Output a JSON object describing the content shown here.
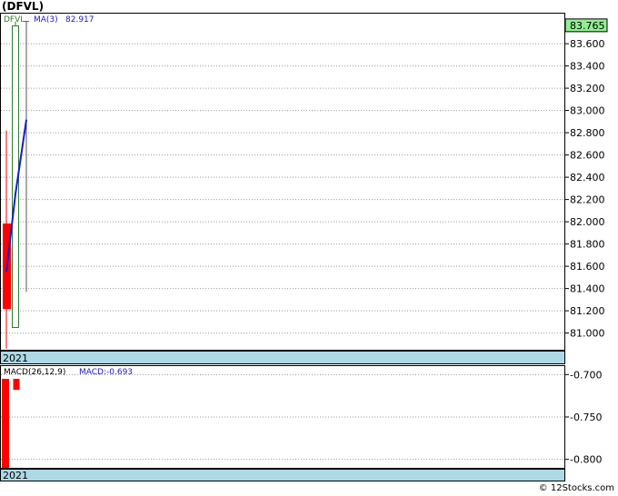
{
  "header": {
    "title": "(DFVL)"
  },
  "price_panel": {
    "legend_symbol": "DFVL",
    "legend_ma_label": "MA(3)",
    "legend_ma_value": "82.917",
    "last_price_tag": "83.765",
    "year_label": "2021"
  },
  "macd_panel": {
    "legend_label": "MACD(26,12,9)",
    "legend_value": "MACD:-0.693",
    "year_label": "2021"
  },
  "footer": {
    "watermark": "© 12Stocks.com"
  },
  "colors": {
    "up": "#2e7d2e",
    "down": "#ff0000",
    "ma_line": "#1a1acc",
    "legend_text": "#1a1acc",
    "grid": "#999999",
    "year_bar": "#add8e6",
    "last_price_tag_bg": "#90ee90"
  },
  "chart_data": [
    {
      "type": "candlestick",
      "title": "(DFVL)",
      "series": [
        {
          "name": "DFVL",
          "candles": [
            {
              "open": 81.98,
              "high": 82.82,
              "low": 80.86,
              "close": 81.22
            },
            {
              "open": 81.05,
              "high": 83.8,
              "low": 81.05,
              "close": 83.76
            },
            {
              "open": 83.8,
              "high": 83.8,
              "low": 81.37,
              "close": 83.8
            }
          ]
        },
        {
          "name": "MA(3)",
          "values": [
            81.55,
            82.25,
            82.917
          ]
        }
      ],
      "ylim": [
        80.85,
        83.87
      ],
      "yticks": [
        "81.000",
        "81.200",
        "81.400",
        "81.600",
        "81.800",
        "82.000",
        "82.200",
        "82.400",
        "82.600",
        "82.800",
        "83.000",
        "83.200",
        "83.400",
        "83.600"
      ],
      "last_price": 83.765,
      "x_label": "2021",
      "grid": true
    },
    {
      "type": "bar",
      "title": "MACD(26,12,9)",
      "series": [
        {
          "name": "MACD",
          "values": [
            -0.81,
            -0.718
          ]
        }
      ],
      "ylim": [
        -0.81,
        -0.69
      ],
      "yticks": [
        "-0.700",
        "-0.750",
        "-0.800"
      ],
      "last_value": -0.693,
      "x_label": "2021",
      "grid": true
    }
  ]
}
